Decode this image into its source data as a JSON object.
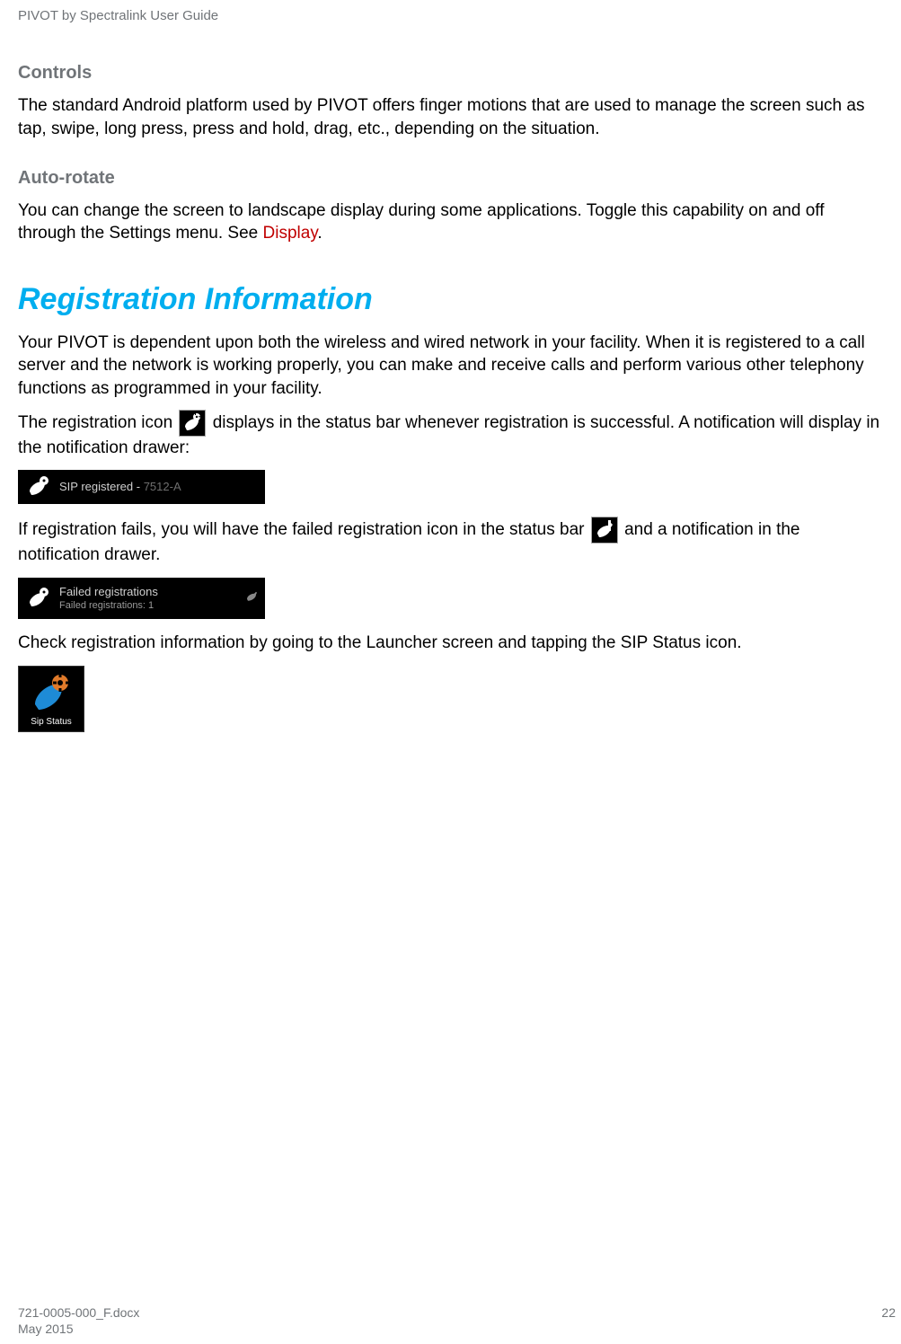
{
  "header": {
    "title": "PIVOT by Spectralink User Guide"
  },
  "sections": {
    "controls": {
      "heading": "Controls",
      "body": "The standard Android platform used by PIVOT offers finger motions that are used to manage the screen such as tap, swipe, long press, press and hold, drag, etc., depending on the situation."
    },
    "autorotate": {
      "heading": "Auto-rotate",
      "body_pre": "You can change the screen to landscape display during some applications. Toggle this capability on and off through the Settings menu. See ",
      "link": "Display",
      "body_post": "."
    },
    "registration": {
      "title": "Registration Information",
      "p1": "Your PIVOT is dependent upon both the wireless and wired network in your facility. When it is registered to a call server and the network is working properly, you can make and receive calls and perform various other telephony functions as programmed in your facility.",
      "p2_pre": "The registration icon ",
      "p2_post": " displays in the status bar whenever registration is successful. A notification will display in the notification drawer:",
      "notif_success_label": "SIP registered - ",
      "notif_success_ext": "7512-A",
      "p3_pre": "If registration fails, you will have the failed registration icon in the status bar ",
      "p3_post": " and a notification in the notification drawer.",
      "notif_fail_line1": "Failed registrations",
      "notif_fail_line2": "Failed registrations: 1",
      "p4": "Check registration information by going to the Launcher screen and tapping the SIP Status icon.",
      "sip_status_label": "Sip Status"
    }
  },
  "footer": {
    "filename": "721-0005-000_F.docx",
    "date": "May 2015",
    "page": "22"
  }
}
